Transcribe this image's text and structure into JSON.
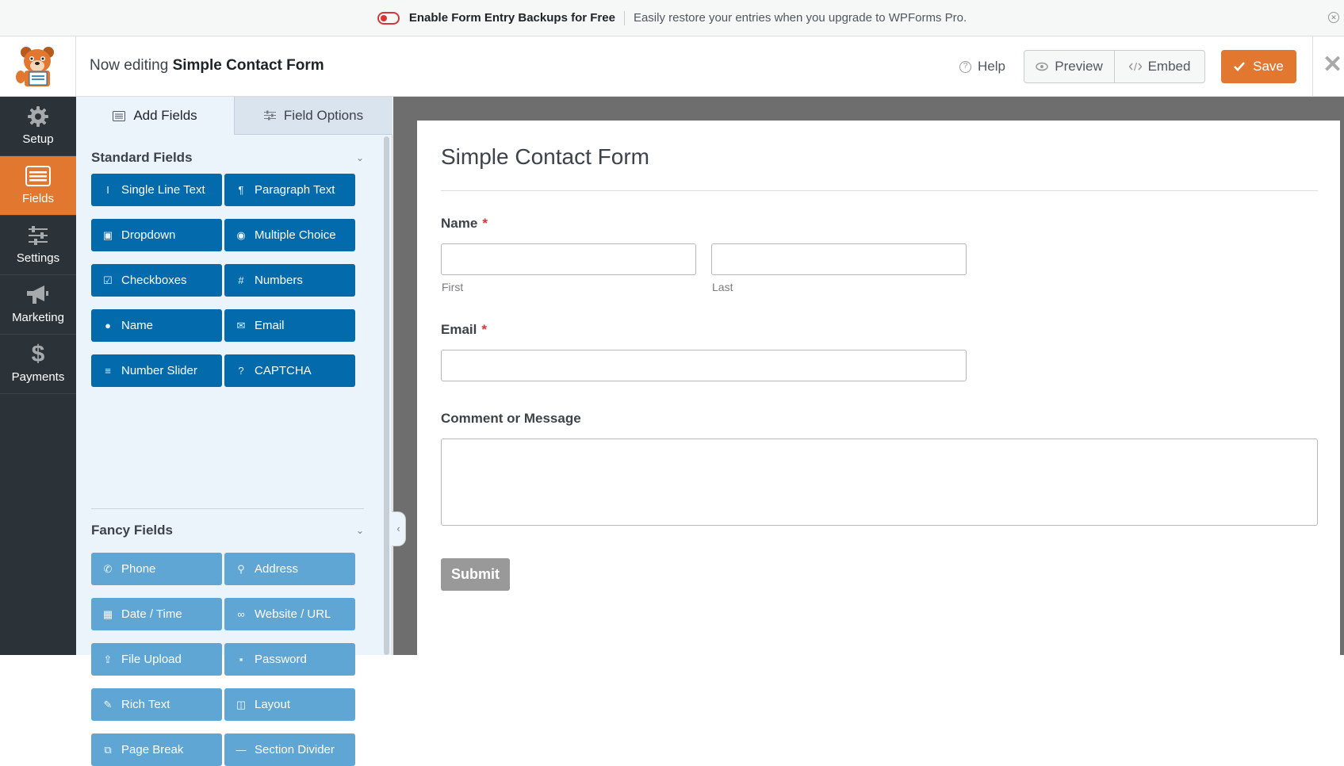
{
  "notice": {
    "title": "Enable Form Entry Backups for Free",
    "message": "Easily restore your entries when you upgrade to WPForms Pro."
  },
  "header": {
    "editing_prefix": "Now editing",
    "form_name": "Simple Contact Form",
    "help": "Help",
    "preview": "Preview",
    "embed": "Embed",
    "save": "Save"
  },
  "nav": {
    "items": [
      {
        "label": "Setup",
        "icon": "gear-icon"
      },
      {
        "label": "Fields",
        "icon": "list-icon"
      },
      {
        "label": "Settings",
        "icon": "sliders-icon"
      },
      {
        "label": "Marketing",
        "icon": "megaphone-icon"
      },
      {
        "label": "Payments",
        "icon": "dollar-icon"
      }
    ],
    "active": "Fields"
  },
  "panel": {
    "tabs": {
      "add": "Add Fields",
      "options": "Field Options"
    },
    "standard": {
      "title": "Standard Fields",
      "fields": [
        "Single Line Text",
        "Paragraph Text",
        "Dropdown",
        "Multiple Choice",
        "Checkboxes",
        "Numbers",
        "Name",
        "Email",
        "Number Slider",
        "CAPTCHA"
      ]
    },
    "fancy": {
      "title": "Fancy Fields",
      "fields": [
        "Phone",
        "Address",
        "Date / Time",
        "Website / URL",
        "File Upload",
        "Password",
        "Rich Text",
        "Layout",
        "Page Break",
        "Section Divider"
      ]
    }
  },
  "form": {
    "title": "Simple Contact Form",
    "name_label": "Name",
    "first_sub": "First",
    "last_sub": "Last",
    "email_label": "Email",
    "comment_label": "Comment or Message",
    "required_mark": "*",
    "submit": "Submit"
  },
  "colors": {
    "accent": "#e27730",
    "standard_button": "#036aab",
    "fancy_button": "#5fa6d5",
    "sidebar": "#2c3338",
    "panel": "#ebf3fb"
  }
}
